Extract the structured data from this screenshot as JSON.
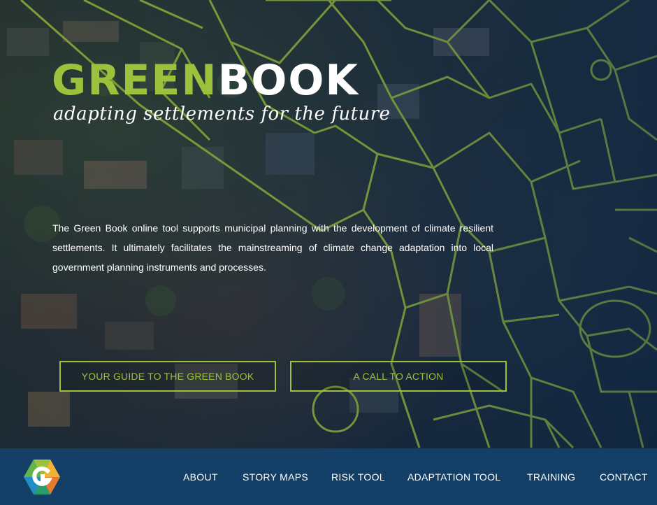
{
  "brand": {
    "title_part_green": "GREEN",
    "title_part_white": "BOOK",
    "tagline": "adapting settlements for the future",
    "logo_icon": "greenbook-hexagon-logo-icon",
    "colors": {
      "accent_green": "#9cc13c",
      "navbar_blue": "#133f66",
      "text_white": "#ffffff"
    }
  },
  "hero": {
    "intro": "The Green Book online tool supports municipal planning with the development of climate resilient settlements. It ultimately facilitates the mainstreaming of climate change adaptation into local government planning instruments and processes.",
    "buttons": [
      {
        "label": "YOUR GUIDE TO THE GREEN BOOK"
      },
      {
        "label": "A CALL TO ACTION"
      }
    ]
  },
  "nav": {
    "items": [
      {
        "label": "ABOUT"
      },
      {
        "label": "STORY MAPS"
      },
      {
        "label": "RISK TOOL"
      },
      {
        "label": "ADAPTATION TOOL"
      },
      {
        "label": "TRAINING"
      },
      {
        "label": "CONTACT"
      }
    ]
  }
}
